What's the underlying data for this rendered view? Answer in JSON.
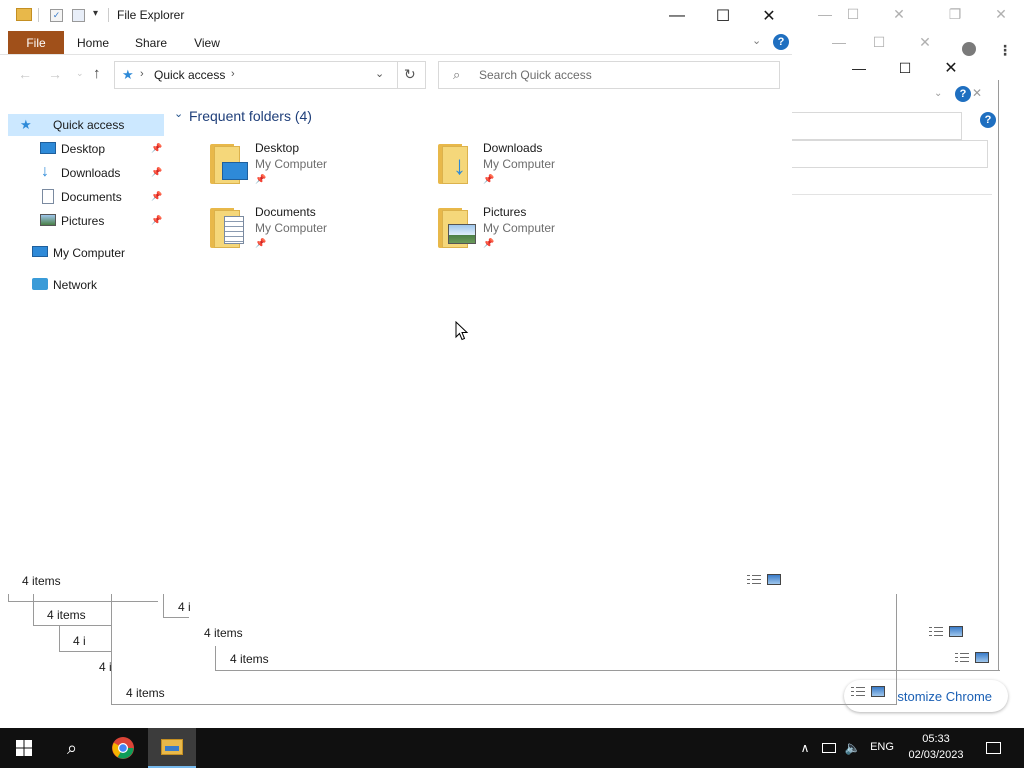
{
  "window": {
    "title": "File Explorer",
    "tabs": [
      "File",
      "Home",
      "Share",
      "View"
    ],
    "help_label": "?"
  },
  "address": {
    "current": "Quick access",
    "search_placeholder": "Search Quick access"
  },
  "nav": {
    "quick_access": "Quick access",
    "items": [
      {
        "label": "Desktop",
        "icon": "desktop-icon"
      },
      {
        "label": "Downloads",
        "icon": "downloads-icon"
      },
      {
        "label": "Documents",
        "icon": "documents-icon"
      },
      {
        "label": "Pictures",
        "icon": "pictures-icon"
      }
    ],
    "my_computer": "My Computer",
    "network": "Network"
  },
  "content": {
    "group_header": "Frequent folders (4)",
    "tiles": [
      {
        "name": "Desktop",
        "location": "My Computer"
      },
      {
        "name": "Downloads",
        "location": "My Computer"
      },
      {
        "name": "Documents",
        "location": "My Computer"
      },
      {
        "name": "Pictures",
        "location": "My Computer"
      }
    ]
  },
  "status": {
    "main": "4 items",
    "stacked": [
      "4 items",
      "4 i",
      "4 i",
      "4 i",
      "4 items",
      "4 items",
      "4 items"
    ]
  },
  "background": {
    "chrome_link": "stomize Chrome"
  },
  "taskbar": {
    "time": "05:33",
    "date": "02/03/2023",
    "language": "ENG"
  },
  "colors": {
    "file_tab": "#a0501a",
    "selection": "#cce8ff",
    "accent_blue": "#1f6fc0",
    "taskbar": "#101010"
  }
}
